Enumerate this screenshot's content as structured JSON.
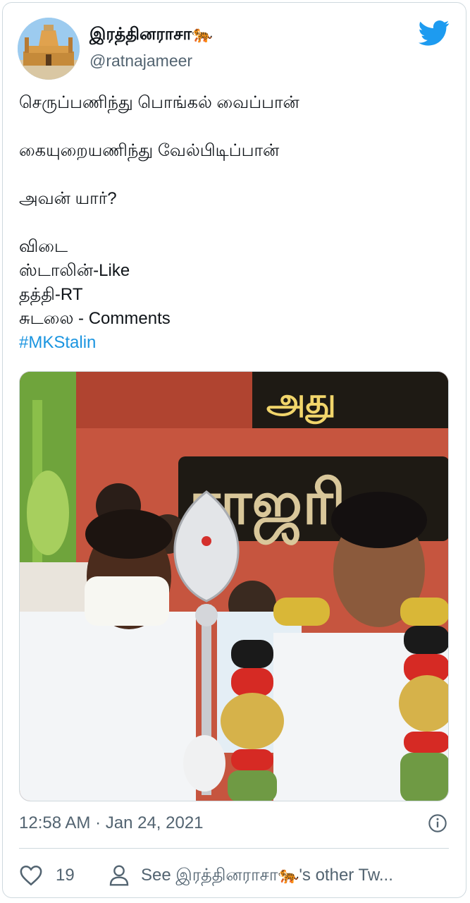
{
  "tweet": {
    "display_name": "இரத்தினராசா🐅",
    "handle": "@ratnajameer",
    "body_lines": [
      "செருப்பணிந்து பொங்கல் வைப்பான்",
      "",
      "கையுறையணிந்து வேல்பிடிப்பான்",
      "",
      "அவன் யார்?",
      "",
      "விடை",
      "ஸ்டாலின்-Like",
      "தத்தி-RT",
      "சுடலை - Comments"
    ],
    "hashtag": "#MKStalin",
    "timestamp": "12:58 AM · Jan 24, 2021",
    "like_count": "19",
    "other_tweets_label": "See இரத்தினராசா🐅's other Tw..."
  },
  "media": {
    "banner_text": "ராஜரி"
  },
  "icons": {
    "brand": "twitter-bird-icon",
    "info": "info-icon",
    "like": "heart-icon",
    "profile": "person-icon"
  },
  "colors": {
    "brand_blue": "#1d9bf0",
    "link_blue": "#1b95e0",
    "secondary_text": "#536471",
    "border": "#cfd9de"
  }
}
